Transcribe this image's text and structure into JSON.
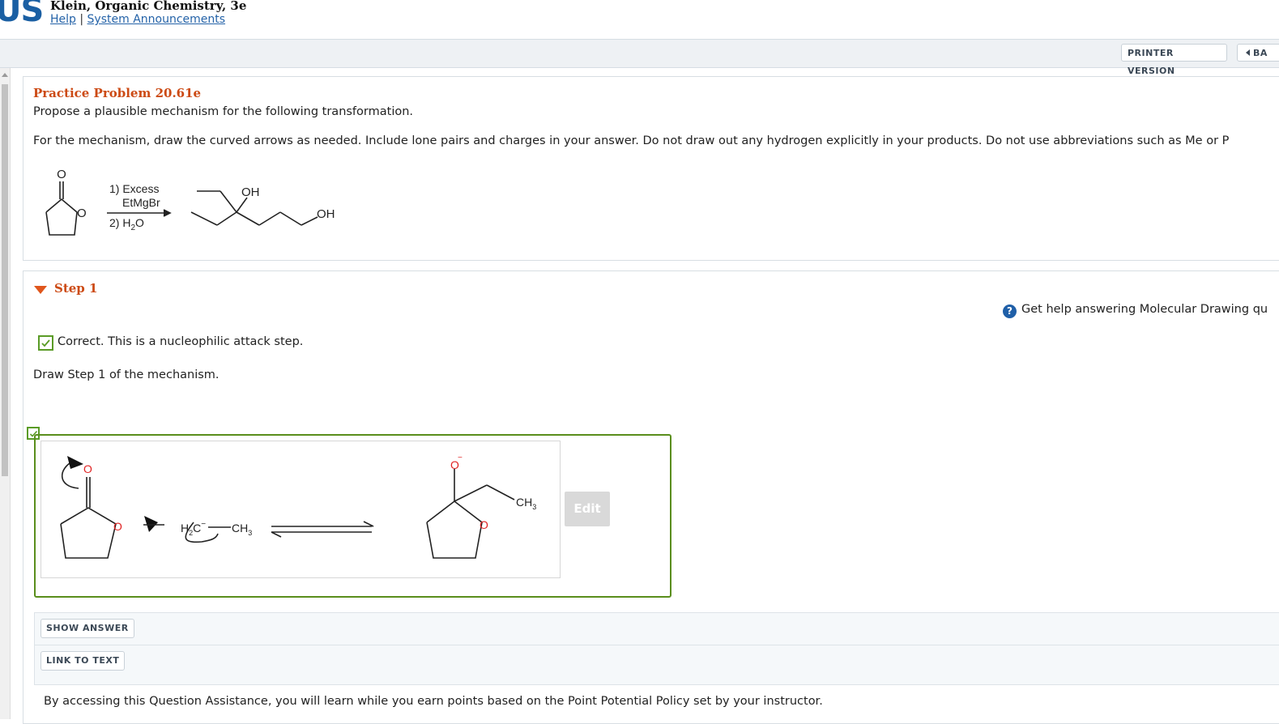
{
  "header": {
    "logo_text": "US",
    "book_title": "Klein, Organic Chemistry, 3e",
    "help_link": "Help",
    "separator": "|",
    "announcements_link": "System Announcements"
  },
  "toolbar": {
    "printer_label": "PRINTER VERSION",
    "back_label": "BA"
  },
  "problem": {
    "title": "Practice Problem 20.61e",
    "prompt": "Propose a plausible mechanism for the following transformation.",
    "instructions": "For the mechanism, draw the curved arrows as needed. Include lone pairs and charges in your answer. Do not draw out any hydrogen explicitly in your products. Do not use abbreviations such as Me or P",
    "reagent_1": "1) Excess",
    "reagent_1b": "EtMgBr",
    "reagent_2": "2) H",
    "reagent_2_sub": "2",
    "reagent_2_end": "O",
    "product_oh1": "OH",
    "product_oh2": "OH",
    "ring_o": "O",
    "carbonyl_o": "O"
  },
  "step": {
    "label": "Step 1",
    "help_text": "Get help answering Molecular Drawing qu",
    "help_icon": "?",
    "feedback": "Correct. This is a nucleophilic attack step.",
    "draw_prompt": "Draw Step 1 of the mechanism.",
    "edit_label": "Edit",
    "canvas": {
      "o_top": "O",
      "o_ring": "O",
      "nucleophile_h": "H",
      "nucleophile_sub": "2",
      "nucleophile_c": "C",
      "nucleophile_charge": "−",
      "ch3": "CH",
      "ch3_sub": "3",
      "product_o": "O",
      "product_charge": "−",
      "product_ring_o": "O",
      "product_ch3": "CH",
      "product_ch3_sub": "3"
    }
  },
  "assist": {
    "show_answer": "SHOW ANSWER",
    "link_to_text": "LINK TO TEXT",
    "policy": "By accessing this Question Assistance, you will learn while you earn points based on the Point Potential Policy set by your instructor."
  },
  "colors": {
    "brand": "#1a5fa3",
    "title_orange": "#cc4a14",
    "correct_green": "#5a8e1c",
    "oxygen_red": "#e02424"
  }
}
